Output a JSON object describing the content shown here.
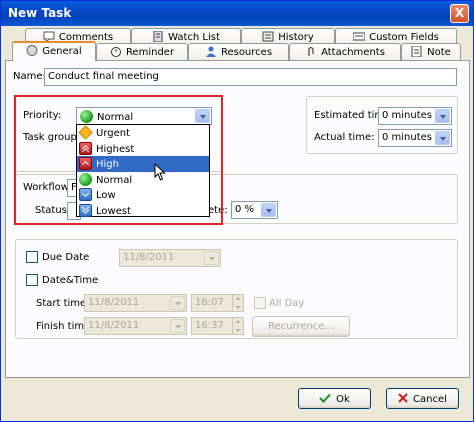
{
  "window": {
    "title": "New Task",
    "close_glyph": "X"
  },
  "tabs_row1": [
    {
      "label": "Comments",
      "icon": "comment-icon"
    },
    {
      "label": "Watch List",
      "icon": "watch-list-icon"
    },
    {
      "label": "History",
      "icon": "history-icon"
    },
    {
      "label": "Custom Fields",
      "icon": "custom-fields-icon"
    }
  ],
  "tabs_row2": [
    {
      "label": "General",
      "icon": "general-icon",
      "active": true
    },
    {
      "label": "Reminder",
      "icon": "reminder-icon"
    },
    {
      "label": "Resources",
      "icon": "resources-icon"
    },
    {
      "label": "Attachments",
      "icon": "attachment-icon"
    },
    {
      "label": "Note",
      "icon": "note-icon"
    }
  ],
  "general": {
    "name_label": "Name:",
    "name_value": "Conduct final meeting",
    "priority_label": "Priority:",
    "priority_value": "Normal",
    "task_group_label": "Task group:",
    "workflow_label": "Workflow:",
    "workflow_value": "F",
    "status_label": "Status:",
    "complete_label_fragment": "ete:",
    "complete_value": "0 %",
    "estimated_time_label": "Estimated time:",
    "estimated_time_value": "0 minutes",
    "actual_time_label": "Actual time:",
    "actual_time_value": "0 minutes"
  },
  "priority_options": [
    {
      "label": "Urgent",
      "icon": "urgent-icon"
    },
    {
      "label": "Highest",
      "icon": "highest-icon"
    },
    {
      "label": "High",
      "icon": "high-icon",
      "selected": true
    },
    {
      "label": "Normal",
      "icon": "normal-icon"
    },
    {
      "label": "Low",
      "icon": "low-icon"
    },
    {
      "label": "Lowest",
      "icon": "lowest-icon"
    }
  ],
  "dates": {
    "due_date_label": "Due Date",
    "due_date_value": "11/8/2011",
    "date_time_label": "Date&Time",
    "start_time_label": "Start time:",
    "start_date_value": "11/8/2011",
    "start_time_value": "16:07",
    "all_day_label": "All Day",
    "finish_time_label": "Finish time:",
    "finish_date_value": "11/8/2011",
    "finish_time_value": "16:37",
    "recurrence_label": "Recurrence..."
  },
  "footer": {
    "ok_label": "Ok",
    "cancel_label": "Cancel"
  },
  "colors": {
    "highlight": "#e0262a",
    "selection": "#316ac5",
    "titlebar": "#0746c4"
  }
}
